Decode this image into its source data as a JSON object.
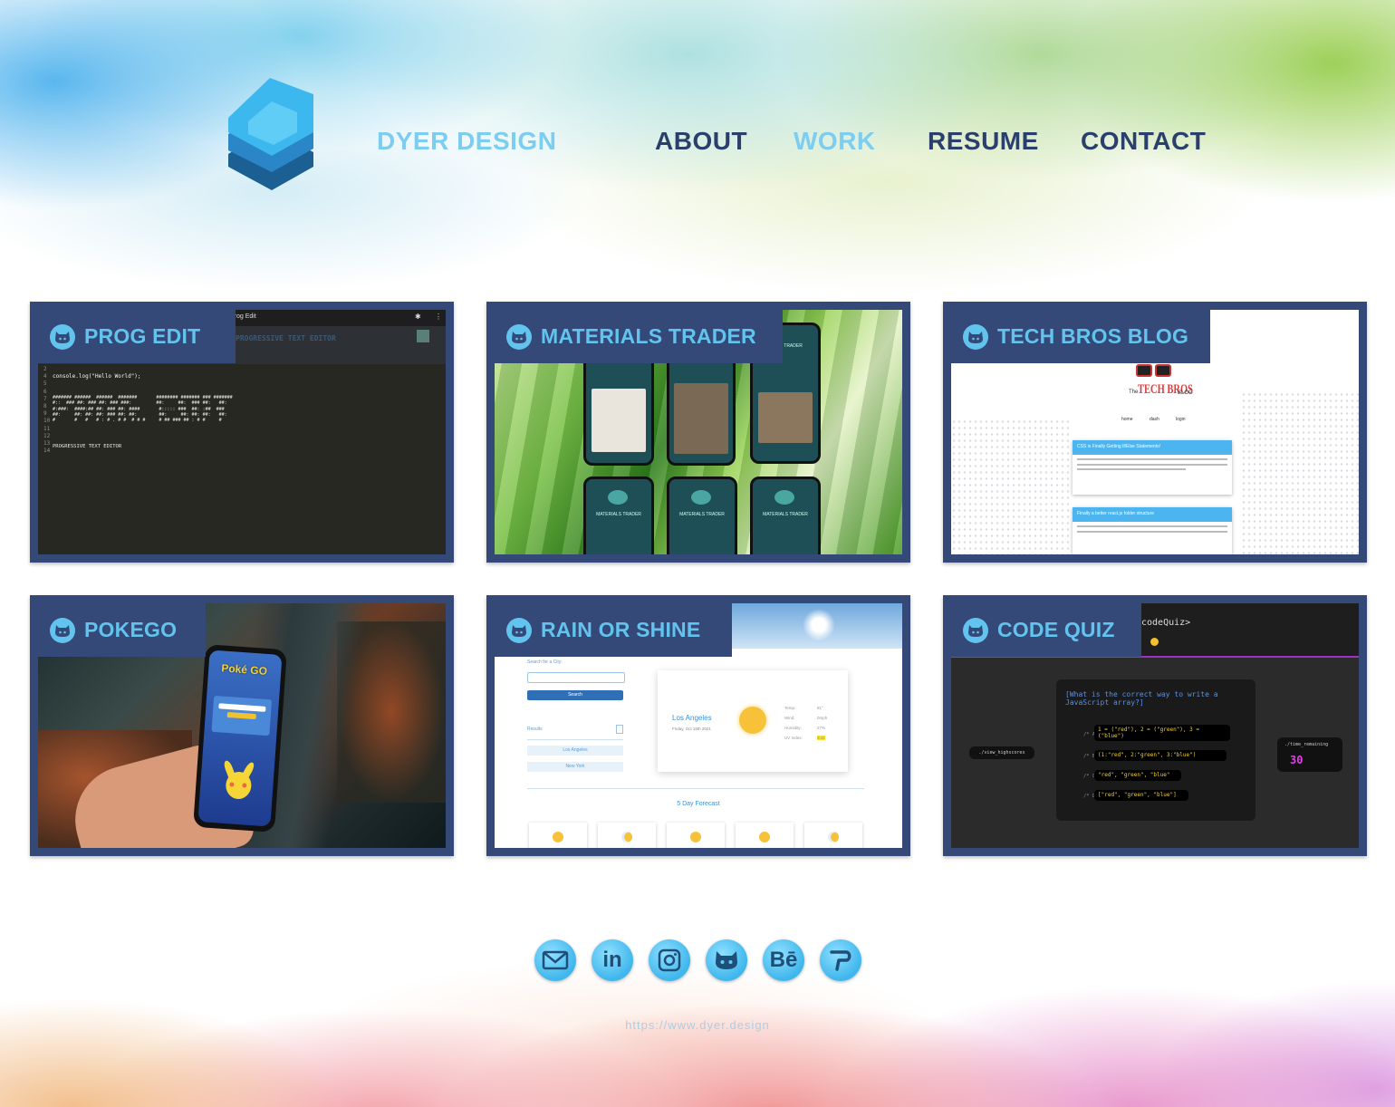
{
  "header": {
    "brand": "DYER DESIGN",
    "nav": [
      {
        "label": "ABOUT",
        "active": false
      },
      {
        "label": "WORK",
        "active": true
      },
      {
        "label": "RESUME",
        "active": false
      },
      {
        "label": "CONTACT",
        "active": false
      }
    ]
  },
  "projects": [
    {
      "title": "PROG EDIT",
      "window_title": "Prog Edit",
      "code_line": "console.log(\"Hello World\");",
      "footer_line": "PROGRESSIVE TEXT EDITOR",
      "banner": "PROGRESSIVE TEXT EDITOR"
    },
    {
      "title": "MATERIALS TRADER",
      "phone_title": "MATERIALS TRADER"
    },
    {
      "title": "TECH BROS BLOG",
      "blog_name": "TECH BROS",
      "blog_pre": "The",
      "blog_post": "BLOG",
      "nav": [
        "home",
        "dash",
        "login"
      ],
      "post1_title": "CSS is Finally Getting If/Else Statements!",
      "post2_title": "Finally a better react.js folder structure"
    },
    {
      "title": "POKEGO",
      "brand": "Poké GO"
    },
    {
      "title": "RAIN OR SHINE",
      "search_label": "Search for a City:",
      "search_button": "Search",
      "results_label": "Results",
      "cities": [
        "Los Angeles",
        "New York"
      ],
      "city": "Los Angeles",
      "date": "Friday, Oct 15th 2021",
      "stats": [
        [
          "Temp:",
          "81°"
        ],
        [
          "Wind:",
          "0mph"
        ],
        [
          "Humidity:",
          "27%"
        ],
        [
          "UV Index:",
          "3.42"
        ]
      ],
      "forecast_label": "5 Day Forecast"
    },
    {
      "title": "CODE QUIZ",
      "app_name": "codeQuiz>",
      "question": "[What is the correct way to write a JavaScript array?]",
      "answers": [
        {
          "key": "/* A",
          "text": "1 = (\"red\"), 2 = (\"green\"), 3 = (\"blue\")"
        },
        {
          "key": "/* B",
          "text": "(1:\"red\", 2:\"green\", 3:\"blue\")"
        },
        {
          "key": "/* C",
          "text": "\"red\", \"green\", \"blue\""
        },
        {
          "key": "/* D",
          "text": "[\"red\", \"green\", \"blue\"]"
        }
      ],
      "highscores": "./view_highscores",
      "time_label": "./time_remaining",
      "time_value": "30"
    }
  ],
  "social": [
    {
      "name": "email-icon",
      "glyph": "✉"
    },
    {
      "name": "linkedin-icon",
      "glyph": "in"
    },
    {
      "name": "instagram-icon",
      "glyph": "◙"
    },
    {
      "name": "github-icon",
      "glyph": "◉"
    },
    {
      "name": "behance-icon",
      "glyph": "Bē"
    },
    {
      "name": "portfolio-icon",
      "glyph": "P"
    }
  ],
  "footer": {
    "url": "https://www.dyer.design"
  },
  "colors": {
    "accent": "#62c4ee",
    "navy": "#344978",
    "nav_text": "#2b3f6c"
  }
}
